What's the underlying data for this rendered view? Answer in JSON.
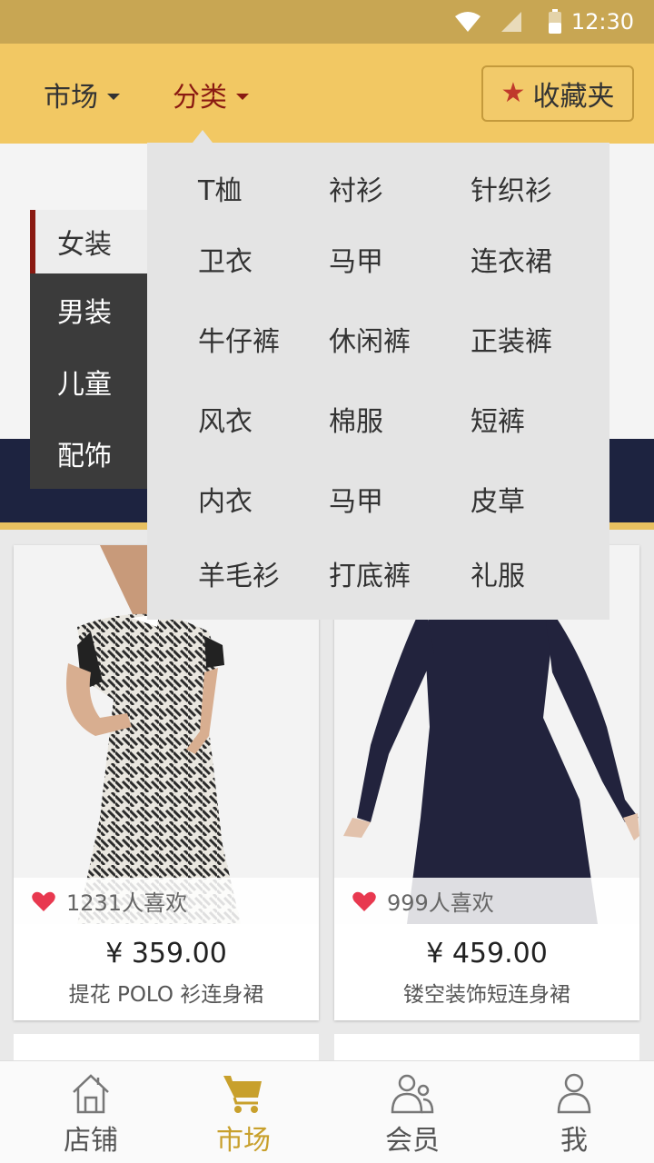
{
  "status_bar": {
    "time": "12:30"
  },
  "top_nav": {
    "market_label": "市场",
    "category_label": "分类",
    "favorites_label": "收藏夹",
    "active_tab": "分类"
  },
  "side_categories": [
    {
      "label": "女装",
      "active": true
    },
    {
      "label": "男装",
      "active": false
    },
    {
      "label": "儿童",
      "active": false
    },
    {
      "label": "配饰",
      "active": false
    }
  ],
  "dropdown": {
    "rows": [
      [
        "T桖",
        "衬衫",
        "针织衫"
      ],
      [
        "卫衣",
        "马甲",
        "连衣裙"
      ],
      [
        "牛仔裤",
        "休闲裤",
        "正装裤"
      ],
      [
        "风衣",
        "棉服",
        "短裤"
      ],
      [
        "内衣",
        "马甲",
        "皮草"
      ],
      [
        "羊毛衫",
        "打底裤",
        "礼服"
      ]
    ]
  },
  "products": [
    {
      "likes": "1231人喜欢",
      "price": "¥ 359.00",
      "name": "提花 POLO 衫连身裙",
      "dress_color": "#2b2b2b"
    },
    {
      "likes": "999人喜欢",
      "price": "¥ 459.00",
      "name": "镂空装饰短连身裙",
      "dress_color": "#22233d"
    }
  ],
  "tab_bar": {
    "items": [
      {
        "label": "店铺",
        "icon": "store-icon"
      },
      {
        "label": "市场",
        "icon": "cart-icon",
        "active": true
      },
      {
        "label": "会员",
        "icon": "members-icon"
      },
      {
        "label": "我",
        "icon": "user-icon"
      }
    ]
  },
  "colors": {
    "accent_gold": "#f2c863",
    "status_bar": "#c8a653",
    "active_red": "#8a1a12",
    "tab_active": "#c8a02c",
    "heart": "#e8384f"
  }
}
